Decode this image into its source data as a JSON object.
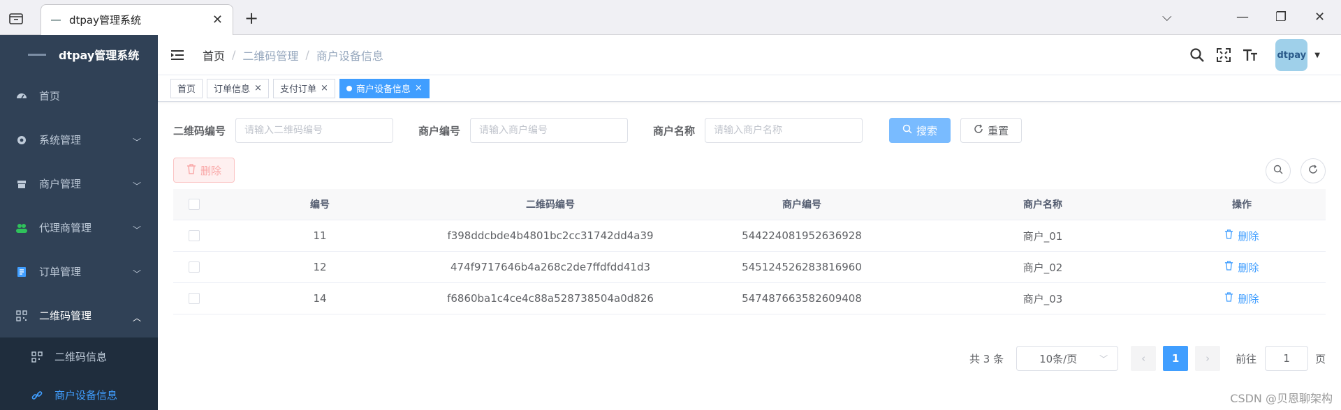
{
  "browser": {
    "tab_title": "dtpay管理系统",
    "tab_close": "✕",
    "new_tab": "+",
    "win_chevron": "⌵",
    "win_minimize": "—",
    "win_restore": "❐",
    "win_close": "✕"
  },
  "sidebar": {
    "logo_text": "dtpay管理系统",
    "items": [
      {
        "label": "首页",
        "icon": "dashboard-icon"
      },
      {
        "label": "系统管理",
        "icon": "gear-icon"
      },
      {
        "label": "商户管理",
        "icon": "shop-icon"
      },
      {
        "label": "代理商管理",
        "icon": "people-icon"
      },
      {
        "label": "订单管理",
        "icon": "order-icon"
      },
      {
        "label": "二维码管理",
        "icon": "qrcode-icon"
      }
    ],
    "sub_items": [
      {
        "label": "二维码信息",
        "icon": "qrcode-icon"
      },
      {
        "label": "商户设备信息",
        "icon": "link-icon"
      }
    ]
  },
  "navbar": {
    "breadcrumb": [
      "首页",
      "二维码管理",
      "商户设备信息"
    ],
    "avatar_text": "dtpay"
  },
  "tags": [
    {
      "label": "首页",
      "active": false
    },
    {
      "label": "订单信息",
      "active": false
    },
    {
      "label": "支付订单",
      "active": false
    },
    {
      "label": "商户设备信息",
      "active": true
    }
  ],
  "search": {
    "qr_label": "二维码编号",
    "qr_placeholder": "请输入二维码编号",
    "mno_label": "商户编号",
    "mno_placeholder": "请输入商户编号",
    "mname_label": "商户名称",
    "mname_placeholder": "请输入商户名称",
    "search_btn": "搜索",
    "reset_btn": "重置"
  },
  "toolbar": {
    "delete_btn": "删除"
  },
  "table": {
    "headers": [
      "编号",
      "二维码编号",
      "商户编号",
      "商户名称",
      "操作"
    ],
    "rows": [
      {
        "id": "11",
        "qr": "f398ddcbde4b4801bc2cc31742dd4a39",
        "mno": "544224081952636928",
        "mname": "商户_01",
        "op": "删除"
      },
      {
        "id": "12",
        "qr": "474f9717646b4a268c2de7ffdfdd41d3",
        "mno": "545124526283816960",
        "mname": "商户_02",
        "op": "删除"
      },
      {
        "id": "14",
        "qr": "f6860ba1c4ce4c88a528738504a0d826",
        "mno": "547487663582609408",
        "mname": "商户_03",
        "op": "删除"
      }
    ]
  },
  "pagination": {
    "total": "共 3 条",
    "page_size": "10条/页",
    "current_page": "1",
    "goto_label": "前往",
    "goto_value": "1",
    "page_suffix": "页"
  },
  "watermark": "CSDN @贝恩聊架构"
}
